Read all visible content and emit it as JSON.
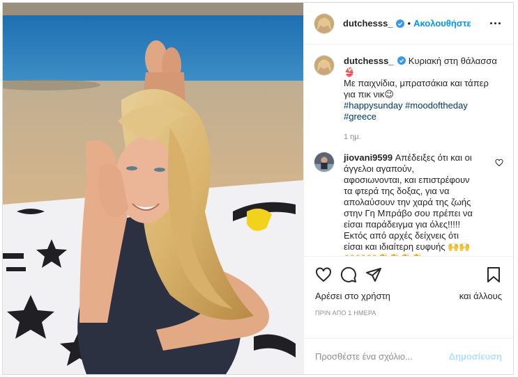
{
  "post": {
    "username": "dutchesss_",
    "follow_label": "Ακολουθήστε",
    "separator": "•"
  },
  "caption": {
    "username": "dutchesss_",
    "line1": "Κυριακή στη θάλασσα",
    "line1_emoji": "👙",
    "line2": "Με παιχνίδια, μπρατσάκια και τάπερ",
    "line3": "για πικ νικ😉",
    "hashtags_line1": "#happysunday #moodoftheday",
    "hashtags_line2": "#greece",
    "time": "1 ημ."
  },
  "comment": {
    "username": "jiovani9599",
    "lines": [
      "Απέδειξες ότι και οι",
      "άγγελοι αγαπούν,",
      "αφοσιωνονται, και επιστρέφουν",
      "τα φτερά της δοξας, για να",
      "απολαύσουν την χαρά της ζωής",
      "στην Γη Μπράβο σου πρέπει να",
      "είσαι παράδειγμα για όλες!!!!!",
      "Εκτός από αρχές δείχνεις ότι",
      "είσαι και ιδιαίτερη ευφυής 🙌🙌",
      "🙌🙌🙌👏👏👏👏"
    ]
  },
  "actions": {
    "likes_left": "Αρέσει στο χρήστη",
    "likes_right": "και άλλους",
    "posted_ago": "ΠΡΙΝ ΑΠΟ 1 ΗΜΕΡΑ"
  },
  "add_comment": {
    "placeholder": "Προσθέστε ένα σχόλιο...",
    "post_label": "Δημοσίευση"
  },
  "icons": [
    "more-options-icon",
    "verified-icon",
    "heart-icon",
    "comment-icon",
    "share-icon",
    "bookmark-icon",
    "heart-small-icon"
  ],
  "colors": {
    "link": "#0095f6",
    "hashtag": "#00376b",
    "muted": "#8e8e8e",
    "post_disabled": "#b2dffc"
  }
}
